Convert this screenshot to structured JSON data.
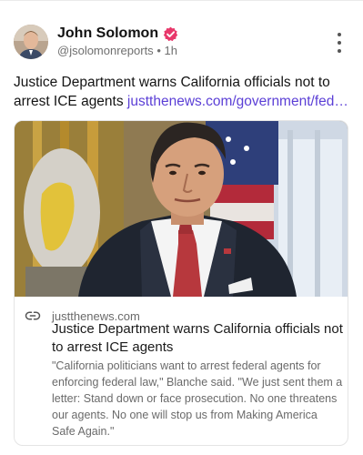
{
  "post": {
    "author_name": "John Solomon",
    "handle": "@jsolomonreports",
    "separator": "•",
    "time": "1h",
    "text": "Justice Department warns California officials not to arrest ICE agents",
    "link_text": "justthenews.com/government/fed…",
    "accent_color": "#5b3fd6"
  },
  "card": {
    "domain": "justthenews.com",
    "title": "Justice Department warns California officials not to arrest ICE agents",
    "description": "\"California politicians want to arrest federal agents for enforcing federal law,\" Blanche said. \"We just sent them a letter: Stand down or face prosecution. No one threatens our agents. No one will stop us from Making America Safe Again.\""
  },
  "icons": {
    "verified": "verified-badge-icon",
    "more": "more-options-icon",
    "link": "link-icon"
  }
}
